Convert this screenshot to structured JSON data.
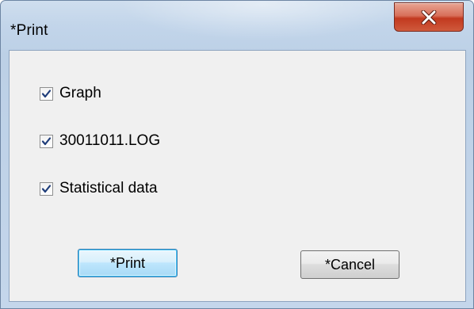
{
  "window": {
    "title": "*Print",
    "close_icon": "close-x-icon"
  },
  "options": [
    {
      "label": "Graph",
      "checked": true
    },
    {
      "label": "30011011.LOG",
      "checked": true
    },
    {
      "label": "Statistical data",
      "checked": true
    }
  ],
  "buttons": {
    "print_label": "*Print",
    "cancel_label": "*Cancel"
  },
  "colors": {
    "close_button": "#c7452b",
    "check_mark": "#1f3d7a",
    "default_button_border": "#3c7fb1"
  }
}
